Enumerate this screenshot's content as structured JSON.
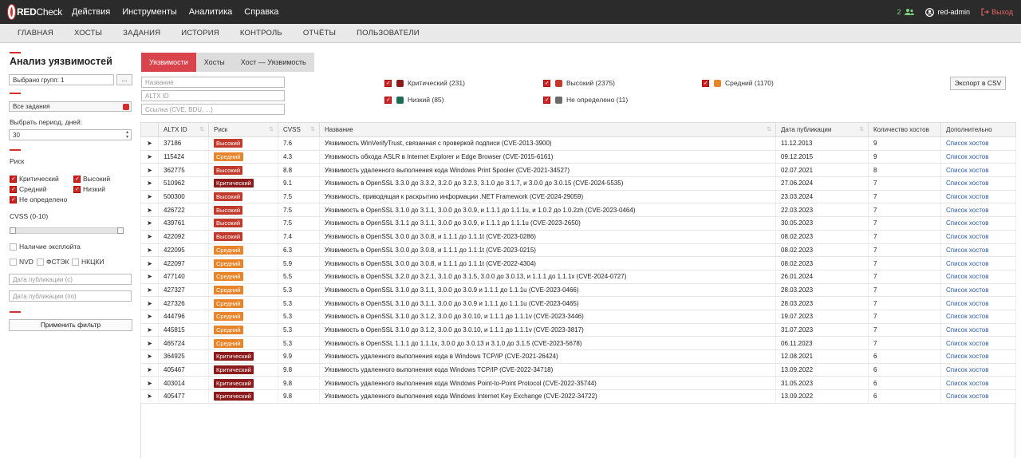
{
  "topbar": {
    "logo_red": "RED",
    "logo_check": "Check",
    "menu": [
      "Действия",
      "Инструменты",
      "Аналитика",
      "Справка"
    ],
    "notif_count": "2",
    "user": "red-admin",
    "logout": "Выход"
  },
  "nav": [
    "ГЛАВНАЯ",
    "ХОСТЫ",
    "ЗАДАНИЯ",
    "ИСТОРИЯ",
    "КОНТРОЛЬ",
    "ОТЧЁТЫ",
    "ПОЛЬЗОВАТЕЛИ"
  ],
  "filters": {
    "title": "Анализ уязвимостей",
    "groups_value": "Выбрано групп: 1",
    "groups_btn": "...",
    "tasks_value": "Все задания",
    "period_label": "Выбрать период, дней:",
    "period_value": "30",
    "risk_label": "Риск",
    "risk_critical": "Критический",
    "risk_high": "Высокий",
    "risk_medium": "Средний",
    "risk_low": "Низкий",
    "risk_undef": "Не определено",
    "cvss_label": "CVSS (0-10)",
    "exploit_label": "Наличие эксплойта",
    "src_nvd": "NVD",
    "src_fstek": "ФСТЭК",
    "src_nkcki": "НКЦКИ",
    "date_from_ph": "Дата публикации (с)",
    "date_to_ph": "Дата публикации (по)",
    "apply": "Применить фильтр"
  },
  "tabs": [
    "Уязвимости",
    "Хосты",
    "Хост — Уязвимость"
  ],
  "search": {
    "name_ph": "Название",
    "altx_ph": "ALTX ID",
    "ref_ph": "Ссылка (CVE, BDU, ...)"
  },
  "legend": {
    "critical": "Критический (231)",
    "high": "Высокий (2375)",
    "medium": "Средний (1170)",
    "low": "Низкий (85)",
    "undef": "Не определено (11)",
    "colors": {
      "critical": "#8b1a1a",
      "high": "#c0392b",
      "medium": "#e8852a",
      "low": "#1b6e55",
      "undef": "#6b6b6b"
    }
  },
  "export": "Экспорт в CSV",
  "table": {
    "headers": [
      "ALTX ID",
      "Риск",
      "CVSS",
      "Название",
      "Дата публикации",
      "Количество хостов",
      "Дополнительно"
    ],
    "link_text": "Список хостов",
    "rows": [
      {
        "id": "37186",
        "risk": "Высокий",
        "cls": "b-high",
        "cvss": "7.6",
        "name": "Уязвимость WinVerifyTrust, связанная с проверкой подписи (CVE-2013-3900)",
        "date": "11.12.2013",
        "hosts": "9"
      },
      {
        "id": "115424",
        "risk": "Средний",
        "cls": "b-med",
        "cvss": "4.3",
        "name": "Уязвимость обхода ASLR в Internet Explorer и Edge Browser (CVE-2015-6161)",
        "date": "09.12.2015",
        "hosts": "9"
      },
      {
        "id": "362775",
        "risk": "Высокий",
        "cls": "b-high",
        "cvss": "8.8",
        "name": "Уязвимость удаленного выполнения кода Windows Print Spooler (CVE-2021-34527)",
        "date": "02.07.2021",
        "hosts": "8"
      },
      {
        "id": "510962",
        "risk": "Критический",
        "cls": "b-crit",
        "cvss": "9.1",
        "name": "Уязвимость в OpenSSL 3.3.0 до 3.3.2, 3.2.0 до 3.2.3, 3.1.0 до 3.1.7, и 3.0.0 до 3.0.15 (CVE-2024-5535)",
        "date": "27.06.2024",
        "hosts": "7"
      },
      {
        "id": "500300",
        "risk": "Высокий",
        "cls": "b-high",
        "cvss": "7.5",
        "name": "Уязвимость, приводящая к раскрытию информации .NET Framework (CVE-2024-29059)",
        "date": "23.03.2024",
        "hosts": "7"
      },
      {
        "id": "426722",
        "risk": "Высокий",
        "cls": "b-high",
        "cvss": "7.5",
        "name": "Уязвимость в OpenSSL 3.1.0 до 3.1.1, 3.0.0 до 3.0.9, и 1.1.1 до 1.1.1u, и 1.0.2 до 1.0.2zh (CVE-2023-0464)",
        "date": "22.03.2023",
        "hosts": "7"
      },
      {
        "id": "439761",
        "risk": "Высокий",
        "cls": "b-high",
        "cvss": "7.5",
        "name": "Уязвимость в OpenSSL 3.1.1 до 3.1.1, 3.0.0 до 3.0.9, и 1.1.1 до 1.1.1u (CVE-2023-2650)",
        "date": "30.05.2023",
        "hosts": "7"
      },
      {
        "id": "422092",
        "risk": "Высокий",
        "cls": "b-high",
        "cvss": "7.4",
        "name": "Уязвимость в OpenSSL 3.0.0 до 3.0.8, и 1.1.1 до 1.1.1t (CVE-2023-0286)",
        "date": "08.02.2023",
        "hosts": "7"
      },
      {
        "id": "422095",
        "risk": "Средний",
        "cls": "b-med",
        "cvss": "6.3",
        "name": "Уязвимость в OpenSSL 3.0.0 до 3.0.8, и 1.1.1 до 1.1.1t (CVE-2023-0215)",
        "date": "08.02.2023",
        "hosts": "7"
      },
      {
        "id": "422097",
        "risk": "Средний",
        "cls": "b-med",
        "cvss": "5.9",
        "name": "Уязвимость в OpenSSL 3.0.0 до 3.0.8, и 1.1.1 до 1.1.1t (CVE-2022-4304)",
        "date": "08.02.2023",
        "hosts": "7"
      },
      {
        "id": "477140",
        "risk": "Средний",
        "cls": "b-med",
        "cvss": "5.5",
        "name": "Уязвимость в OpenSSL 3.2.0 до 3.2.1, 3.1.0 до 3.1.5, 3.0.0 до 3.0.13, и 1.1.1 до 1.1.1x (CVE-2024-0727)",
        "date": "26.01.2024",
        "hosts": "7"
      },
      {
        "id": "427327",
        "risk": "Средний",
        "cls": "b-med",
        "cvss": "5.3",
        "name": "Уязвимость в OpenSSL 3.1.0 до 3.1.1, 3.0.0 до 3.0.9 и 1.1.1 до 1.1.1u (CVE-2023-0466)",
        "date": "28.03.2023",
        "hosts": "7"
      },
      {
        "id": "427326",
        "risk": "Средний",
        "cls": "b-med",
        "cvss": "5.3",
        "name": "Уязвимость в OpenSSL 3.1.0 до 3.1.1, 3.0.0 до 3.0.9 и 1.1.1 до 1.1.1u (CVE-2023-0465)",
        "date": "28.03.2023",
        "hosts": "7"
      },
      {
        "id": "444796",
        "risk": "Средний",
        "cls": "b-med",
        "cvss": "5.3",
        "name": "Уязвимость в OpenSSL 3.1.0 до 3.1.2, 3.0.0 до 3.0.10, и 1.1.1 до 1.1.1v (CVE-2023-3446)",
        "date": "19.07.2023",
        "hosts": "7"
      },
      {
        "id": "445815",
        "risk": "Средний",
        "cls": "b-med",
        "cvss": "5.3",
        "name": "Уязвимость в OpenSSL 3.1.0 до 3.1.2, 3.0.0 до 3.0.10, и 1.1.1 до 1.1.1v (CVE-2023-3817)",
        "date": "31.07.2023",
        "hosts": "7"
      },
      {
        "id": "465724",
        "risk": "Средний",
        "cls": "b-med",
        "cvss": "5.3",
        "name": "Уязвимость в OpenSSL 1.1.1 до 1.1.1x, 3.0.0 до 3.0.13 и 3.1.0 до 3.1.5 (CVE-2023-5678)",
        "date": "06.11.2023",
        "hosts": "7"
      },
      {
        "id": "364925",
        "risk": "Критический",
        "cls": "b-crit",
        "cvss": "9.9",
        "name": "Уязвимость удаленного выполнения кода в Windows TCP/IP (CVE-2021-26424)",
        "date": "12.08.2021",
        "hosts": "6"
      },
      {
        "id": "405467",
        "risk": "Критический",
        "cls": "b-crit",
        "cvss": "9.8",
        "name": "Уязвимость удаленного выполнения кода Windows TCP/IP (CVE-2022-34718)",
        "date": "13.09.2022",
        "hosts": "6"
      },
      {
        "id": "403014",
        "risk": "Критический",
        "cls": "b-crit",
        "cvss": "9.8",
        "name": "Уязвимость удаленного выполнения кода Windows Point-to-Point Protocol (CVE-2022-35744)",
        "date": "31.05.2023",
        "hosts": "6"
      },
      {
        "id": "405477",
        "risk": "Критический",
        "cls": "b-crit",
        "cvss": "9.8",
        "name": "Уязвимость удаленного выполнения кода Windows Internet Key Exchange (CVE-2022-34722)",
        "date": "13.09.2022",
        "hosts": "6"
      }
    ]
  }
}
